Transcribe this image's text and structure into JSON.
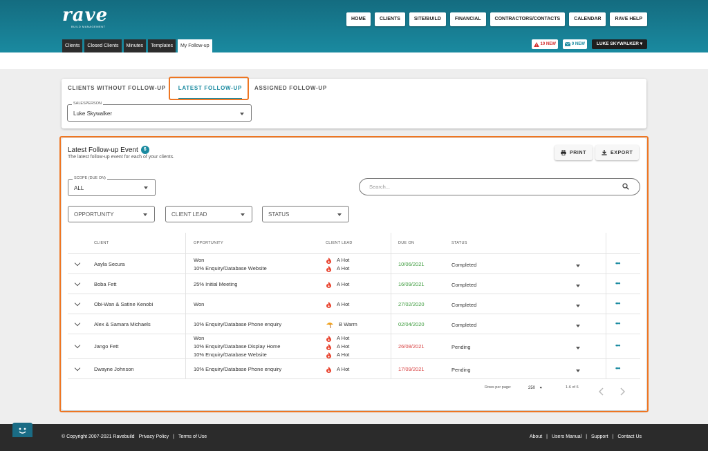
{
  "brand": {
    "logo_text": "rave",
    "logo_sub": "BUILD MANAGEMENT"
  },
  "nav": [
    "HOME",
    "CLIENTS",
    "SITE/BUILD",
    "FINANCIAL",
    "CONTRACTORS/CONTACTS",
    "CALENDAR",
    "RAVE HELP"
  ],
  "module_tabs": [
    "Clients",
    "Closed Clients",
    "Minutes",
    "Templates",
    "My Follow-up"
  ],
  "notifications": {
    "alerts": "10 NEW",
    "messages": "0 NEW"
  },
  "user": {
    "name": "LUKE SKYWALKER"
  },
  "subtabs": [
    "CLIENTS WITHOUT FOLLOW-UP",
    "LATEST FOLLOW-UP",
    "ASSIGNED FOLLOW-UP"
  ],
  "salesperson": {
    "label": "SALESPERSON",
    "value": "Luke Skywalker"
  },
  "panel": {
    "title": "Latest Follow-up Event",
    "count": "6",
    "subtitle": "The latest follow-up event for each of your clients.",
    "print": "PRINT",
    "export": "EXPORT"
  },
  "filters": {
    "scope_label": "SCOPE (DUE ON)",
    "scope_value": "ALL",
    "search_placeholder": "Search...",
    "opportunity": "OPPORTUNITY",
    "client_lead": "CLIENT LEAD",
    "status": "STATUS"
  },
  "columns": [
    "CLIENT",
    "OPPORTUNITY",
    "CLIENT LEAD",
    "DUE ON",
    "STATUS"
  ],
  "rows": [
    {
      "client": "Aayla Secura",
      "opportunity": [
        "Won",
        "10% Enquiry/Database Website"
      ],
      "lead": [
        {
          "icon": "fire-icon",
          "text": "A Hot"
        },
        {
          "icon": "fire-icon",
          "text": "A Hot"
        }
      ],
      "due": "10/06/2021",
      "due_color": "green",
      "status": "Completed"
    },
    {
      "client": "Boba Fett",
      "opportunity": [
        "25% Initial Meeting"
      ],
      "lead": [
        {
          "icon": "fire-icon",
          "text": "A Hot"
        }
      ],
      "due": "16/09/2021",
      "due_color": "green",
      "status": "Completed"
    },
    {
      "client": "Obi-Wan & Satine Kenobi",
      "opportunity": [
        "Won"
      ],
      "lead": [
        {
          "icon": "fire-icon",
          "text": "A Hot"
        }
      ],
      "due": "27/02/2020",
      "due_color": "green",
      "status": "Completed"
    },
    {
      "client": "Alex & Samara Michaels",
      "opportunity": [
        "10% Enquiry/Database Phone enquiry"
      ],
      "lead": [
        {
          "icon": "beach-umbrella-icon",
          "text": "B Warm"
        }
      ],
      "due": "02/04/2020",
      "due_color": "green",
      "status": "Completed"
    },
    {
      "client": "Jango Fett",
      "opportunity": [
        "Won",
        "10% Enquiry/Database Display Home",
        "10% Enquiry/Database Website"
      ],
      "lead": [
        {
          "icon": "fire-icon",
          "text": "A Hot"
        },
        {
          "icon": "fire-icon",
          "text": "A Hot"
        },
        {
          "icon": "fire-icon",
          "text": "A Hot"
        }
      ],
      "due": "26/08/2021",
      "due_color": "red",
      "status": "Pending"
    },
    {
      "client": "Dwayne Johnson",
      "opportunity": [
        "10% Enquiry/Database Phone enquiry"
      ],
      "lead": [
        {
          "icon": "fire-icon",
          "text": "A Hot"
        }
      ],
      "due": "17/09/2021",
      "due_color": "red",
      "status": "Pending"
    }
  ],
  "pagination": {
    "rows_per_page_label": "Rows per page:",
    "rows_per_page": "250",
    "range": "1-6 of 6"
  },
  "footer": {
    "copyright": "© Copyright 2007-2021 Ravebuild",
    "privacy": "Privacy Policy",
    "terms": "Terms of Use",
    "links": [
      "About",
      "Users Manual",
      "Support",
      "Contact Us"
    ]
  },
  "colors": {
    "accent": "#1a8aa0",
    "highlight": "#ee7622",
    "due_ok": "#3a9a3a",
    "due_late": "#d84040"
  }
}
